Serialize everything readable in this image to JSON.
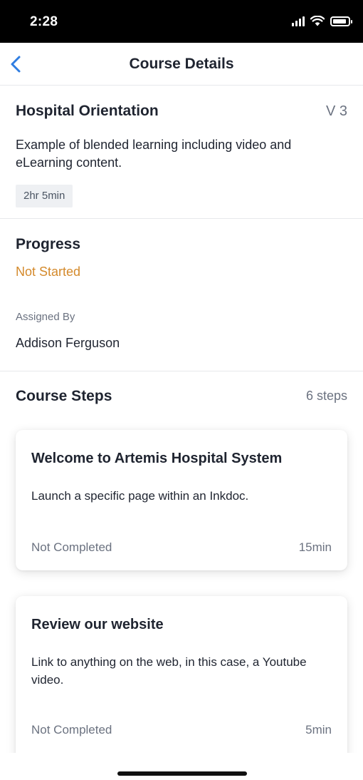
{
  "status_bar": {
    "time": "2:28",
    "icons": [
      "signal-icon",
      "wifi-icon",
      "battery-icon"
    ]
  },
  "nav": {
    "back_icon": "chevron-left-icon",
    "title": "Course Details"
  },
  "course": {
    "title": "Hospital Orientation",
    "version": "V 3",
    "description": "Example of blended learning including video and eLearning content.",
    "duration": "2hr 5min"
  },
  "progress": {
    "heading": "Progress",
    "status": "Not Started",
    "assigned_by_label": "Assigned By",
    "assigned_by_name": "Addison Ferguson"
  },
  "steps": {
    "heading": "Course Steps",
    "count": "6 steps",
    "items": [
      {
        "title": "Welcome to Artemis Hospital System",
        "description": "Launch a specific page within an Inkdoc.",
        "status": "Not Completed",
        "duration": "15min"
      },
      {
        "title": "Review our website",
        "description": "Link to anything on the web, in this case, a Youtube video.",
        "status": "Not Completed",
        "duration": "5min"
      }
    ]
  },
  "colors": {
    "accent_blue": "#2f7de1",
    "status_orange": "#d48a2c",
    "text_primary": "#1f2430",
    "text_secondary": "#6b7280"
  }
}
